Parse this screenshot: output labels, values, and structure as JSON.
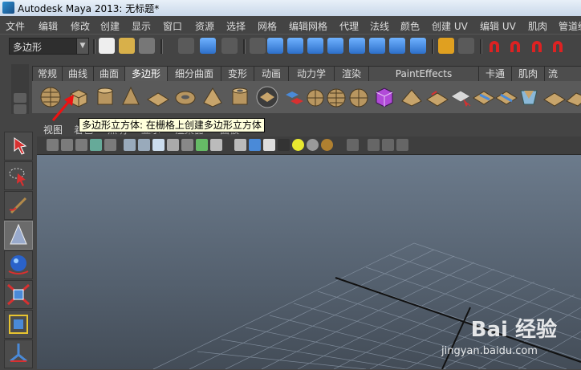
{
  "window": {
    "title": "Autodesk Maya 2013: 无标题*"
  },
  "menu": [
    "文件",
    "编辑",
    "修改",
    "创建",
    "显示",
    "窗口",
    "资源",
    "选择",
    "网格",
    "编辑网格",
    "代理",
    "法线",
    "颜色",
    "创建 UV",
    "编辑 UV",
    "肌肉",
    "管道缓"
  ],
  "status_line": {
    "mode_value": "多边形"
  },
  "shelf": {
    "tabs": [
      "常规",
      "曲线",
      "曲面",
      "多边形",
      "细分曲面",
      "变形",
      "动画",
      "动力学",
      "渲染",
      "PaintEffects",
      "卡通",
      "肌肉",
      "流"
    ],
    "active_tab": "多边形"
  },
  "tooltip": "多边形立方体: 在栅格上创建多边形立方体",
  "viewport_menu": {
    "view_label": "视图",
    "partial_items": [
      "着色",
      "照明",
      "显示",
      "渲染器",
      "面板"
    ]
  },
  "watermark": {
    "brand": "Bai 经验",
    "url": "jingyan.baidu.com"
  },
  "colors": {
    "viewport_top": "#6c7b8c",
    "viewport_bottom": "#434c57",
    "tooltip_bg": "#ffffdc",
    "arrow_red": "#e11"
  }
}
